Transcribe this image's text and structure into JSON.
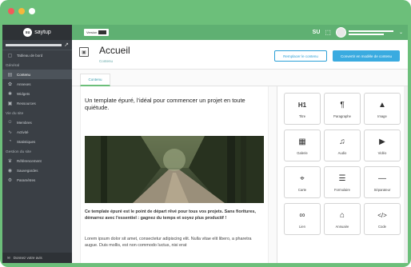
{
  "window": {
    "dots": [
      "#ff5f57",
      "#febc2e",
      "#28c840"
    ]
  },
  "brand": {
    "logo": "su",
    "name": "saytup"
  },
  "sidebar": {
    "top_item": {
      "icon": "site-icon",
      "label": "Tableau de bord"
    },
    "general_title": "Général",
    "general_items": [
      {
        "icon": "content-icon",
        "label": "Contenu",
        "active": true
      },
      {
        "icon": "plugins-icon",
        "label": "Annexes"
      },
      {
        "icon": "widgets-icon",
        "label": "Widgets"
      },
      {
        "icon": "resources-icon",
        "label": "Ressources"
      }
    ],
    "life_title": "Vie du site",
    "life_items": [
      {
        "icon": "members-icon",
        "label": "Membres"
      },
      {
        "icon": "activity-icon",
        "label": "Activité"
      },
      {
        "icon": "stats-icon",
        "label": "Statistiques"
      }
    ],
    "manage_title": "Gestion du site",
    "manage_items": [
      {
        "icon": "seo-icon",
        "label": "Référencement"
      },
      {
        "icon": "backup-icon",
        "label": "Sauvegardes"
      },
      {
        "icon": "settings-icon",
        "label": "Paramètres"
      }
    ],
    "footer": "Donnez votre avis"
  },
  "topbar": {
    "version_label": "Version",
    "su_label": "SU"
  },
  "header": {
    "title": "Accueil",
    "subtitle": "Contenu",
    "replace_button": "Remplacer le contenu",
    "convert_button": "Convertir en modèle de contenu"
  },
  "tabs": [
    {
      "label": "Contenu"
    }
  ],
  "editor": {
    "lead": "Un template épuré, l'idéal pour commencer un projet en toute quiétude.",
    "bold": "Ce template épuré est le point de départ rêvé pour tous vos projets. Sans fioritures, démarrez avec l'essentiel : gagnez du temps et soyez plus productif !",
    "lorem": "Lorem ipsum dolor sit amet, consectetur adipiscing elit. Nulla vitae elit libero, a pharetra augue. Duis mollis, est non commodo luctus, nisi erat"
  },
  "blocks": [
    {
      "icon": "title-icon",
      "glyph": "H1",
      "label": "Titre"
    },
    {
      "icon": "paragraph-icon",
      "glyph": "¶",
      "label": "Paragraphe"
    },
    {
      "icon": "image-icon",
      "glyph": "▲",
      "label": "Image"
    },
    {
      "icon": "gallery-icon",
      "glyph": "▦",
      "label": "Galerie"
    },
    {
      "icon": "audio-icon",
      "glyph": "♫",
      "label": "Audio"
    },
    {
      "icon": "video-icon",
      "glyph": "▶",
      "label": "Vidéo"
    },
    {
      "icon": "map-icon",
      "glyph": "⌖",
      "label": "Carte"
    },
    {
      "icon": "form-icon",
      "glyph": "☰",
      "label": "Formulaire"
    },
    {
      "icon": "separator-icon",
      "glyph": "—",
      "label": "Séparateur"
    },
    {
      "icon": "link-icon",
      "glyph": "∞",
      "label": "Lien"
    },
    {
      "icon": "directory-icon",
      "glyph": "⌂",
      "label": "Annuaire"
    },
    {
      "icon": "code-icon",
      "glyph": "</>",
      "label": "Code"
    }
  ]
}
